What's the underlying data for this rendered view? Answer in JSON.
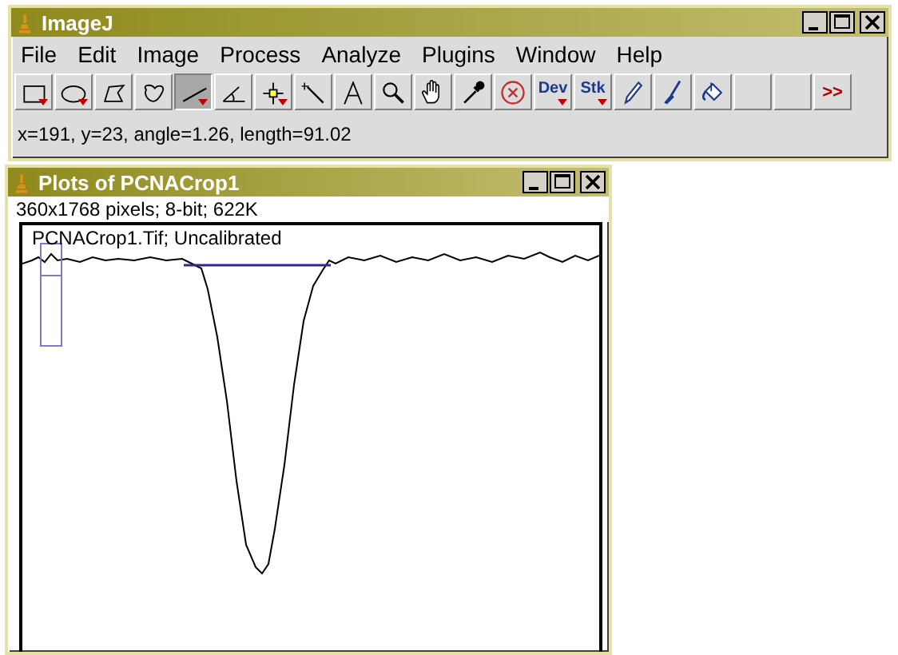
{
  "main_window": {
    "title": "ImageJ",
    "menu": [
      "File",
      "Edit",
      "Image",
      "Process",
      "Analyze",
      "Plugins",
      "Window",
      "Help"
    ],
    "tools": [
      {
        "kind": "icon",
        "selected": false,
        "has_menu": true
      },
      {
        "kind": "icon",
        "selected": false,
        "has_menu": true
      },
      {
        "kind": "icon",
        "selected": false,
        "has_menu": false
      },
      {
        "kind": "icon",
        "selected": false,
        "has_menu": false
      },
      {
        "kind": "icon",
        "selected": true,
        "has_menu": true
      },
      {
        "kind": "icon",
        "selected": false,
        "has_menu": false
      },
      {
        "kind": "icon",
        "selected": false,
        "has_menu": true
      },
      {
        "kind": "icon",
        "selected": false,
        "has_menu": false
      },
      {
        "kind": "icon",
        "selected": false,
        "has_menu": false
      },
      {
        "kind": "icon",
        "selected": false,
        "has_menu": false
      },
      {
        "kind": "icon",
        "selected": false,
        "has_menu": false
      },
      {
        "kind": "icon",
        "selected": false,
        "has_menu": false
      },
      {
        "kind": "icon",
        "selected": false,
        "has_menu": false
      },
      {
        "kind": "text",
        "label": "Dev",
        "selected": false,
        "has_menu": true
      },
      {
        "kind": "text",
        "label": "Stk",
        "selected": false,
        "has_menu": true
      },
      {
        "kind": "icon",
        "selected": false,
        "has_menu": false
      },
      {
        "kind": "icon",
        "selected": false,
        "has_menu": false
      },
      {
        "kind": "icon",
        "selected": false,
        "has_menu": false
      },
      {
        "kind": "blank",
        "selected": false,
        "has_menu": false
      },
      {
        "kind": "blank",
        "selected": false,
        "has_menu": false
      },
      {
        "kind": "more",
        "label": ">>",
        "selected": false,
        "has_menu": false
      }
    ],
    "status": "x=191, y=23, angle=1.26, length=91.02"
  },
  "plot_window": {
    "title": "Plots of PCNACrop1",
    "info": "360x1768 pixels; 8-bit; 622K",
    "plot_label": "PCNACrop1.Tif; Uncalibrated"
  }
}
